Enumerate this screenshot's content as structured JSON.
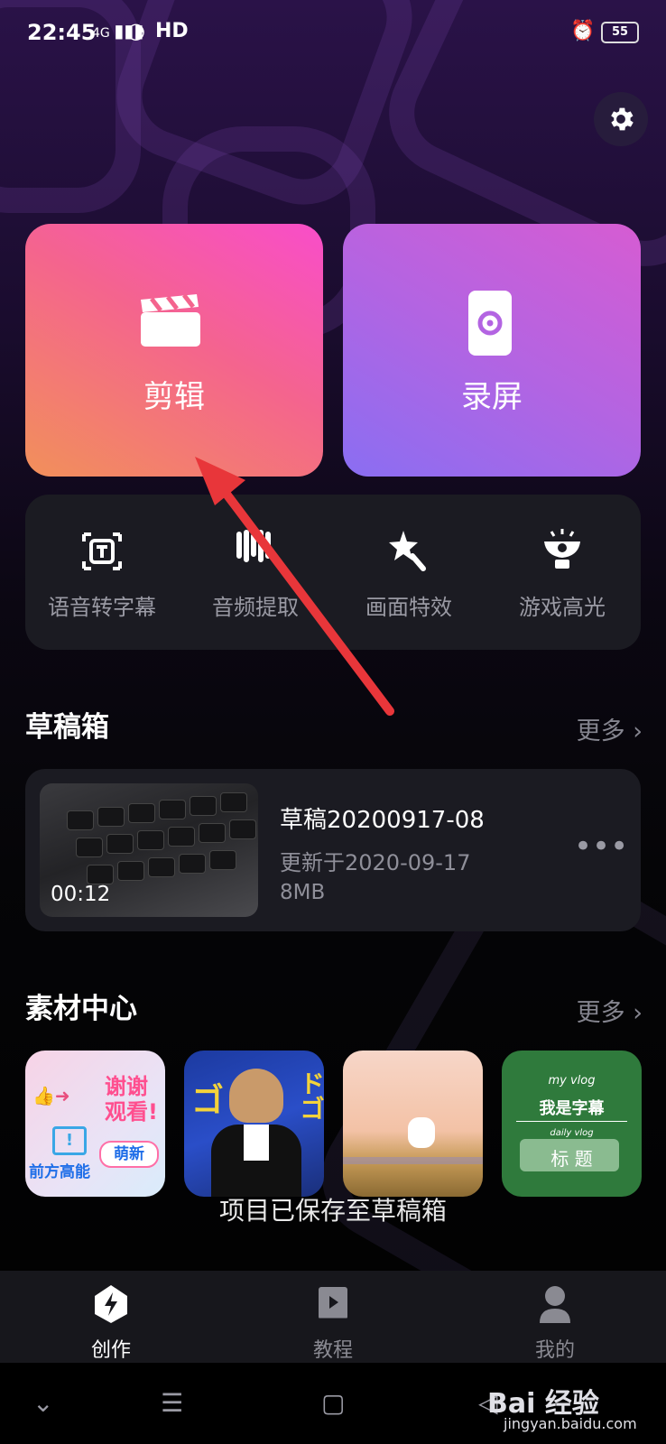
{
  "status_bar": {
    "time": "22:45",
    "signal": "4G",
    "network": "HD",
    "battery": "55"
  },
  "settings_icon": "gear-icon",
  "main_actions": [
    {
      "label": "剪辑",
      "icon": "clapperboard-icon"
    },
    {
      "label": "录屏",
      "icon": "screen-record-icon"
    }
  ],
  "tools": [
    {
      "label": "语音转字幕",
      "icon": "subtitle-icon"
    },
    {
      "label": "音频提取",
      "icon": "audio-extract-icon"
    },
    {
      "label": "画面特效",
      "icon": "effects-wand-icon"
    },
    {
      "label": "游戏高光",
      "icon": "trophy-icon"
    }
  ],
  "drafts": {
    "title": "草稿箱",
    "more": "更多",
    "item": {
      "duration": "00:12",
      "name": "草稿20200917-08",
      "updated": "更新于2020-09-17",
      "size": "8MB"
    }
  },
  "materials": {
    "title": "素材中心",
    "more": "更多",
    "items": [
      {
        "text_a": "谢谢",
        "text_b": "观看!",
        "text_c": "前方高能",
        "text_d": "萌新"
      },
      {
        "text_a": "ゴ",
        "text_b": "ドゴ"
      },
      {
        "text_a": ""
      },
      {
        "text_a": "my vlog",
        "text_b": "我是字幕",
        "text_c": "daily vlog",
        "text_d": "标 题"
      }
    ]
  },
  "toast": "项目已保存至草稿箱",
  "tab_bar": [
    {
      "label": "创作",
      "icon": "lightning-icon",
      "active": true
    },
    {
      "label": "教程",
      "icon": "play-book-icon",
      "active": false
    },
    {
      "label": "我的",
      "icon": "user-icon",
      "active": false
    }
  ],
  "watermark": {
    "brand": "Bai 经验",
    "url": "jingyan.baidu.com"
  },
  "colors": {
    "edit_card": "#f4648e",
    "record_card": "#b364e2",
    "annotation_arrow": "#e8363a"
  }
}
